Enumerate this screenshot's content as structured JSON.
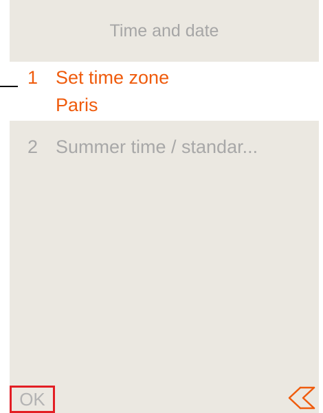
{
  "header": {
    "title": "Time and date"
  },
  "menu": {
    "items": [
      {
        "number": "1",
        "label": "Set time zone",
        "value": "Paris",
        "selected": true
      },
      {
        "number": "2",
        "label": "Summer time / standar...",
        "selected": false
      }
    ]
  },
  "footer": {
    "ok_label": "OK",
    "back_icon": "double-chevron-left-icon"
  },
  "colors": {
    "background": "#ebe8e1",
    "accent": "#ef5b0c",
    "inactive_text": "#a8a8a8",
    "focus_border": "#e31e24"
  }
}
